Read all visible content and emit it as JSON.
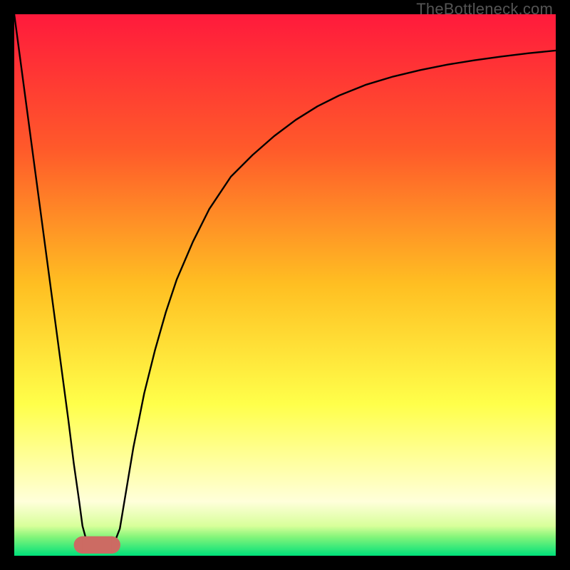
{
  "watermark": "TheBottleneck.com",
  "chart_data": {
    "type": "line",
    "title": "",
    "xlabel": "",
    "ylabel": "",
    "xlim": [
      0,
      100
    ],
    "ylim": [
      0,
      100
    ],
    "grid": false,
    "legend": false,
    "background_gradient": {
      "stops": [
        {
          "offset": 0.0,
          "color": "#ff1a3c"
        },
        {
          "offset": 0.25,
          "color": "#ff5a2a"
        },
        {
          "offset": 0.5,
          "color": "#ffbf22"
        },
        {
          "offset": 0.72,
          "color": "#ffff4a"
        },
        {
          "offset": 0.82,
          "color": "#ffff9a"
        },
        {
          "offset": 0.9,
          "color": "#ffffda"
        },
        {
          "offset": 0.945,
          "color": "#d8ff9a"
        },
        {
          "offset": 0.965,
          "color": "#85f57a"
        },
        {
          "offset": 1.0,
          "color": "#00e07a"
        }
      ]
    },
    "series": [
      {
        "name": "curve",
        "color": "#000000",
        "width": 2.4,
        "x": [
          0,
          2,
          4,
          6,
          8,
          10,
          11,
          12,
          12.6,
          13.2,
          14,
          15,
          16,
          17,
          18,
          18.8,
          19.5,
          20,
          21,
          22,
          24,
          26,
          28,
          30,
          33,
          36,
          40,
          44,
          48,
          52,
          56,
          60,
          65,
          70,
          75,
          80,
          85,
          90,
          95,
          100
        ],
        "y": [
          100,
          85,
          70,
          55,
          40,
          25,
          17,
          10,
          5.5,
          3.3,
          2,
          2,
          2,
          2,
          2.3,
          3.2,
          5,
          8,
          14,
          20,
          30,
          38,
          45,
          51,
          58,
          64,
          70,
          74,
          77.5,
          80.5,
          83,
          85,
          87,
          88.5,
          89.7,
          90.7,
          91.5,
          92.2,
          92.8,
          93.3
        ]
      }
    ],
    "highlight": {
      "name": "trough-marker",
      "color": "#cc6b63",
      "x_range": [
        12.6,
        18
      ],
      "y": 2,
      "radius_y": 1.6
    }
  }
}
